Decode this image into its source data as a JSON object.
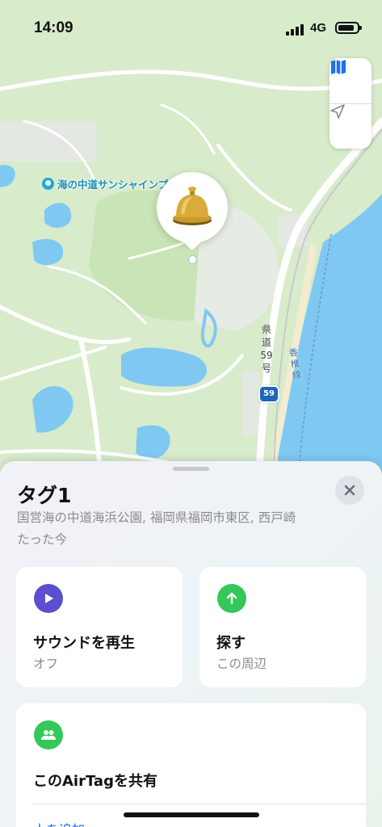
{
  "status_bar": {
    "time": "14:09",
    "network": "4G"
  },
  "map": {
    "poi_label": "海の中道サンシャインプ",
    "road_label": "県道59号",
    "route_number": "59",
    "rail_label": "香椎線",
    "pin_icon": "bell-icon",
    "colors": {
      "land": "#d8ebcb",
      "water": "#7fc8f2",
      "road": "#ffffff"
    }
  },
  "map_controls": {
    "map_mode_icon": "map-icon",
    "locate_icon": "location-arrow-icon"
  },
  "sheet": {
    "title": "タグ1",
    "location": "国営海の中道海浜公園, 福岡県福岡市東区, 西戸崎",
    "updated": "たった今",
    "close_icon": "close-icon",
    "actions": [
      {
        "label": "サウンドを再生",
        "sub": "オフ",
        "icon": "play-icon",
        "color": "#5b4fd1"
      },
      {
        "label": "探す",
        "sub": "この周辺",
        "icon": "arrow-up-icon",
        "color": "#34c759"
      }
    ],
    "share": {
      "title": "このAirTagを共有",
      "icon": "people-icon",
      "color": "#34c759",
      "add_label": "人を追加"
    }
  }
}
